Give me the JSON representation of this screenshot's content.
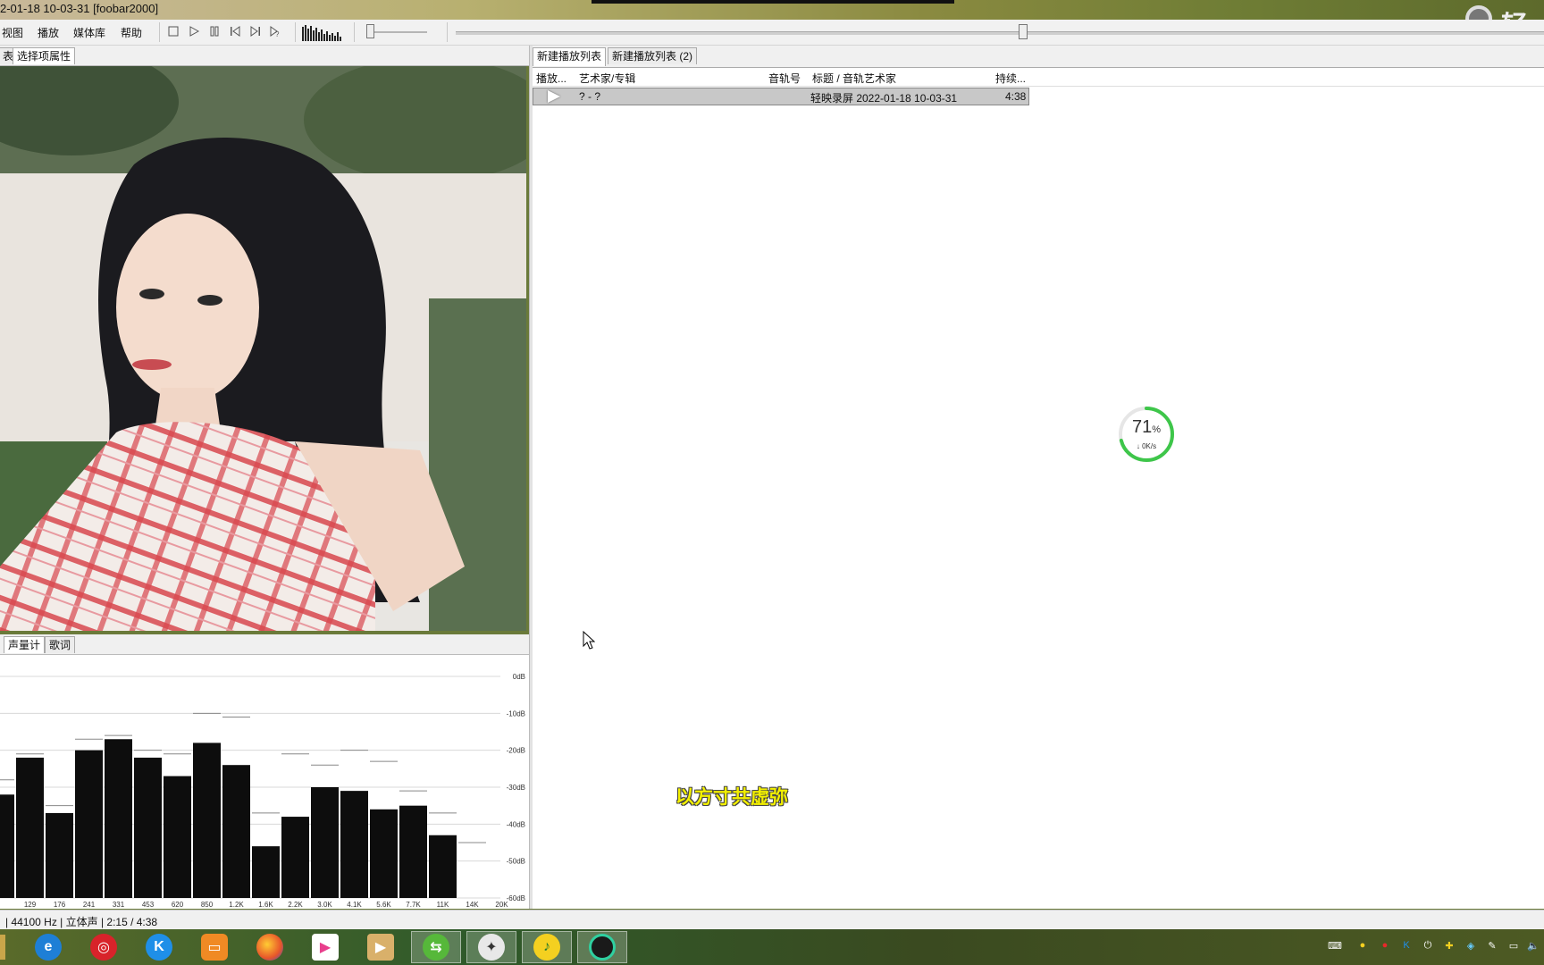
{
  "window": {
    "title": "2-01-18 10-03-31  [foobar2000]",
    "brand_char": "轻"
  },
  "menu": [
    "视图",
    "播放",
    "媒体库",
    "帮助"
  ],
  "left_tabs": [
    "表",
    "选择项属性"
  ],
  "vu_tabs": [
    "声量计",
    "歌词"
  ],
  "spectrum": {
    "db_labels": [
      "0dB",
      "-10dB",
      "-20dB",
      "-30dB",
      "-40dB",
      "-50dB",
      "-60dB"
    ],
    "freq_labels": [
      "129",
      "176",
      "241",
      "331",
      "453",
      "620",
      "850",
      "1.2K",
      "1.6K",
      "2.2K",
      "3.0K",
      "4.1K",
      "5.6K",
      "7.7K",
      "11K",
      "14K",
      "20K"
    ],
    "bars_db": [
      -32,
      -22,
      -37,
      -20,
      -17,
      -22,
      -27,
      -18,
      -24,
      -46,
      -38,
      -30,
      -31,
      -36,
      -35,
      -43,
      -60,
      -60
    ],
    "peaks_db": [
      -28,
      -21,
      -35,
      -17,
      -16,
      -20,
      -21,
      -10,
      -11,
      -37,
      -21,
      -24,
      -20,
      -23,
      -31,
      -37,
      -45,
      -60
    ]
  },
  "playlist_tabs": [
    "新建播放列表",
    "新建播放列表 (2)"
  ],
  "playlist": {
    "columns": [
      "播放...",
      "艺术家/专辑",
      "音轨号",
      "标题 / 音轨艺术家",
      "持续..."
    ],
    "rows": [
      {
        "artist_album": "? - ?",
        "track": "",
        "title": "轻映录屏 2022-01-18 10-03-31",
        "duration": "4:38"
      }
    ]
  },
  "download_gauge": {
    "percent": "71",
    "percent_sign": "%",
    "speed": "0K/s",
    "progress": 0.71
  },
  "lyric_text": "以方寸共虚弥",
  "status": "| 44100 Hz | 立体声 | 2:15 / 4:38",
  "taskbar": {
    "apps": [
      "ie-icon",
      "netease-music-icon",
      "kugou-icon",
      "app-orange-icon",
      "firefox-icon",
      "youku-icon",
      "video-player-icon",
      "vpn-icon",
      "foobar-icon",
      "music-app-icon",
      "record-app-icon"
    ],
    "open_apps": [
      "vpn-icon",
      "foobar-icon",
      "music-app-icon",
      "record-app-icon"
    ]
  },
  "colors": {
    "accent_green": "#3ec64a",
    "lyric_yellow": "#f3f000",
    "selection_gray": "#c8c8c8"
  }
}
